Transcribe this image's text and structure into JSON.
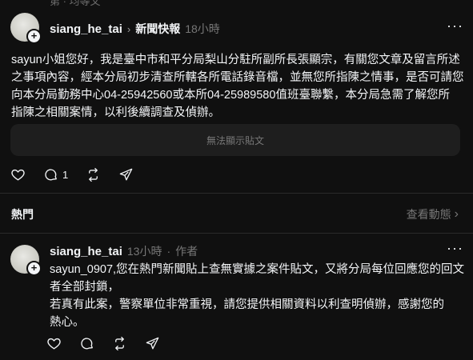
{
  "clipped_top_text": "第 · 均等文",
  "post1": {
    "username": "siang_he_tai",
    "topic": "新聞快報",
    "time": "18小時",
    "body_lines": [
      "sayun小姐您好，我是臺中市和平分局梨山分駐所副所長張顯宗，有關您文章及留言所述",
      "之事項內容，經本分局初步清查所轄各所電話錄音檔，並無您所指陳之情事，是否可請您",
      "向本分局勤務中心04-25942560或本所04-25989580值班臺聯繫，本分局急需了解您所",
      "指陳之相關案情，以利後續調查及偵辦。"
    ],
    "embed_text": "無法顯示貼文",
    "reply_count": "1"
  },
  "hot": {
    "label": "熱門",
    "view_activity": "查看動態"
  },
  "post2": {
    "username": "siang_he_tai",
    "time": "13小時",
    "role": "作者",
    "body_lines": [
      "sayun_0907,您在熱門新聞貼上查無實據之案件貼文，又將分局每位回應您的回文",
      "者全部封鎖，",
      "若真有此案，警察單位非常重視，請您提供相關資料以利查明偵辦，感謝您的",
      "熱心。"
    ]
  },
  "icons": {
    "like": "heart-icon",
    "reply": "comment-icon",
    "repost": "repost-icon",
    "share": "send-icon",
    "more": "more-icon"
  }
}
